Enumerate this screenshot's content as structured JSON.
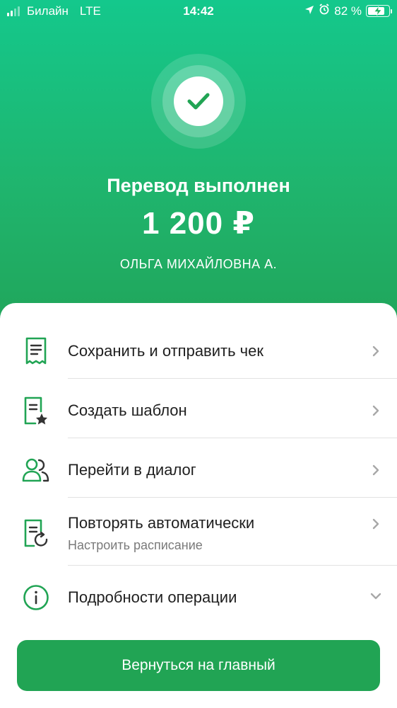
{
  "status_bar": {
    "carrier": "Билайн",
    "network": "LTE",
    "time": "14:42",
    "battery_percent": "82 %",
    "battery_level": 0.82,
    "icons": [
      "location-arrow-icon",
      "alarm-icon",
      "battery-charging-icon"
    ]
  },
  "success": {
    "icon": "checkmark-icon",
    "title": "Перевод выполнен",
    "amount": "1 200 ₽",
    "recipient": "ОЛЬГА МИХАЙЛОВНА А."
  },
  "actions": [
    {
      "icon": "receipt-icon",
      "label": "Сохранить и отправить чек"
    },
    {
      "icon": "template-star-icon",
      "label": "Создать шаблон"
    },
    {
      "icon": "people-icon",
      "label": "Перейти в диалог"
    },
    {
      "icon": "repeat-document-icon",
      "label": "Повторять автоматически",
      "sublabel": "Настроить расписание"
    },
    {
      "icon": "info-icon",
      "label": "Подробности операции"
    }
  ],
  "home_button": {
    "label": "Вернуться на главный"
  },
  "colors": {
    "brand": "#21a454",
    "hero_top": "#14c88c",
    "icon_green": "#21a454"
  }
}
